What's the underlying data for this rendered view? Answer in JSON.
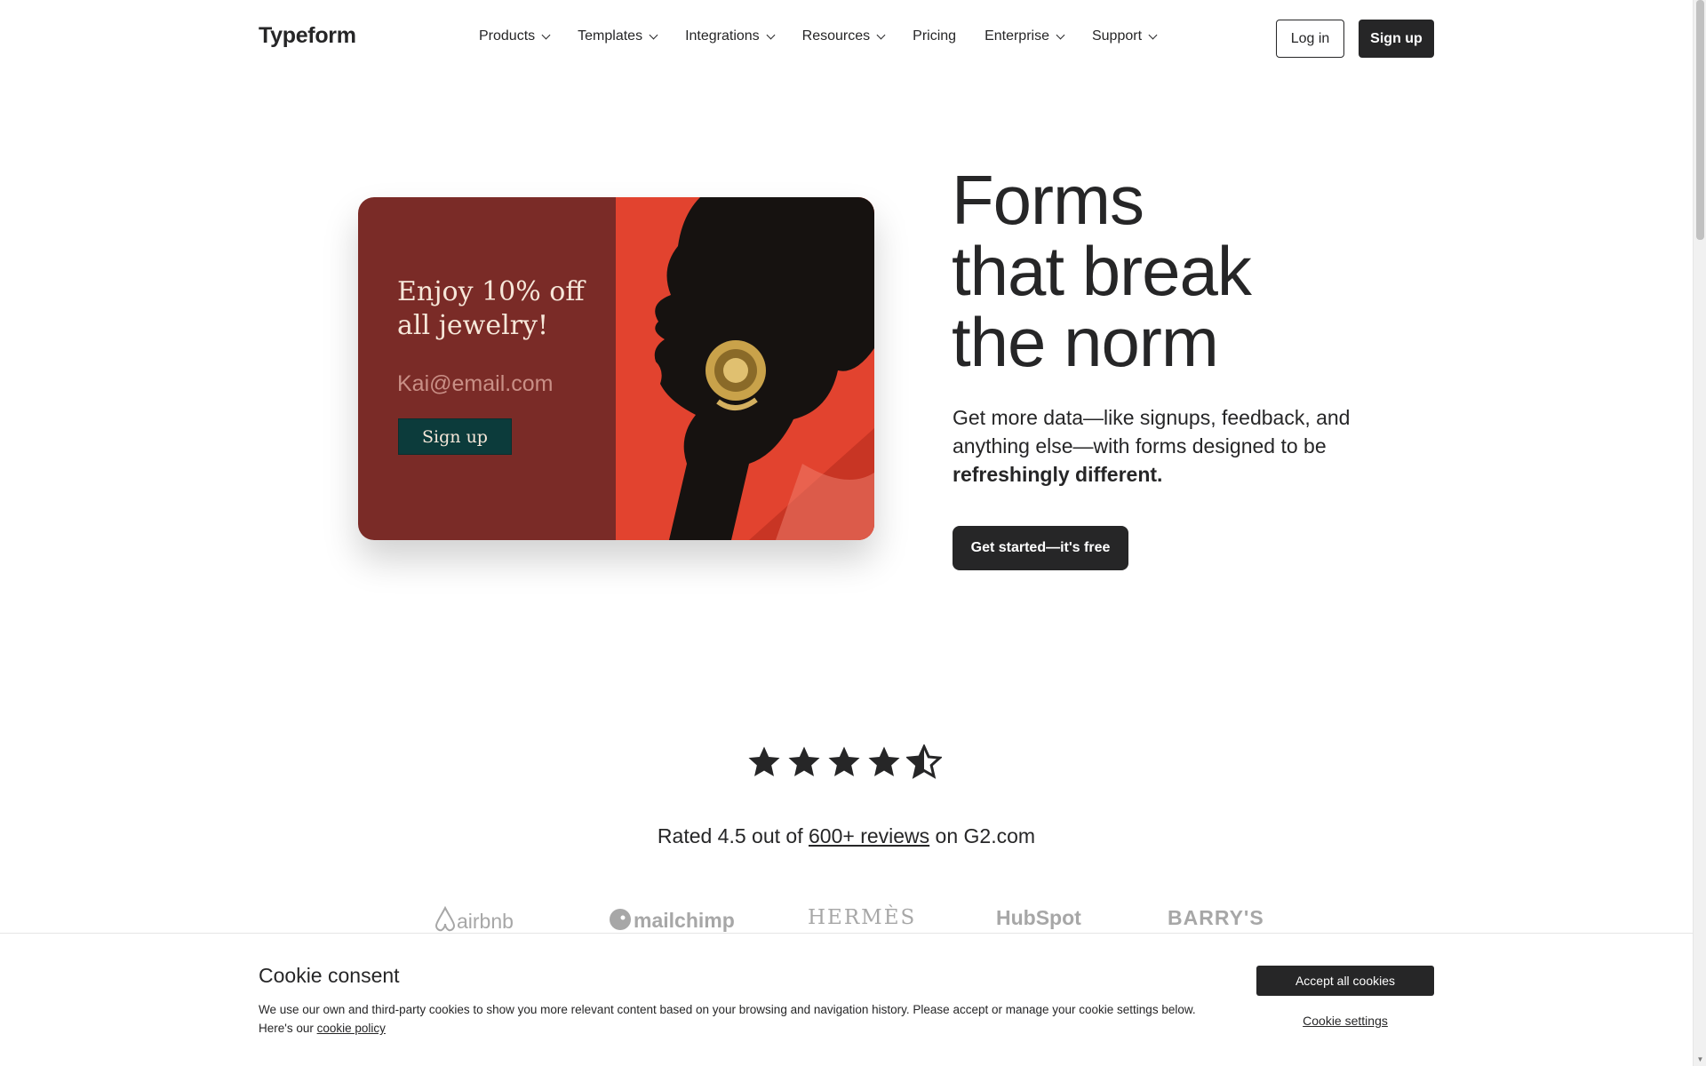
{
  "header": {
    "logo": "Typeform",
    "nav": [
      {
        "label": "Products",
        "dropdown": true
      },
      {
        "label": "Templates",
        "dropdown": true
      },
      {
        "label": "Integrations",
        "dropdown": true
      },
      {
        "label": "Resources",
        "dropdown": true
      },
      {
        "label": "Pricing",
        "dropdown": false
      },
      {
        "label": "Enterprise",
        "dropdown": true
      },
      {
        "label": "Support",
        "dropdown": true
      }
    ],
    "login_label": "Log in",
    "signup_label": "Sign up"
  },
  "hero_card": {
    "headline": "Enjoy 10% off all jewelry!",
    "email_placeholder": "Kai@email.com",
    "button_label": "Sign up",
    "colors": {
      "left": "#7a2b27",
      "right": "#e2432f",
      "button": "#0c3b3b"
    }
  },
  "hero": {
    "title_lines": [
      "Forms",
      "that break",
      "the norm"
    ],
    "subtitle_plain": "Get more data—like signups, feedback, and anything else—with forms designed to be ",
    "subtitle_bold": "refreshingly different.",
    "cta_label": "Get started—it's free"
  },
  "rating": {
    "stars": 4.5,
    "text_before": "Rated 4.5 out of ",
    "link_text": "600+ reviews",
    "text_after": " on G2.com"
  },
  "logos": [
    "airbnb",
    "mailchimp",
    "HERMÈS",
    "HubSpot",
    "BARRY'S"
  ],
  "cookie": {
    "title": "Cookie consent",
    "text": "We use our own and third-party cookies to show you more relevant content based on your browsing and navigation history. Please accept or manage your cookie settings below. Here's our ",
    "link_text": "cookie policy",
    "accept_label": "Accept all cookies",
    "settings_label": "Cookie settings"
  }
}
